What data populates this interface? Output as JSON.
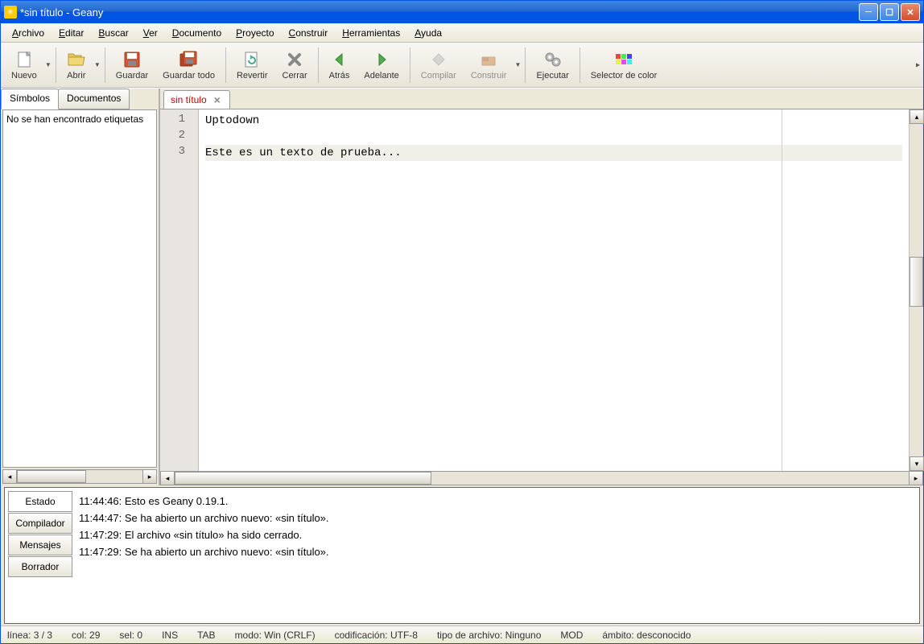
{
  "title": "*sin título - Geany",
  "menu": {
    "archivo": "Archivo",
    "editar": "Editar",
    "buscar": "Buscar",
    "ver": "Ver",
    "documento": "Documento",
    "proyecto": "Proyecto",
    "construir": "Construir",
    "herramientas": "Herramientas",
    "ayuda": "Ayuda"
  },
  "toolbar": {
    "nuevo": "Nuevo",
    "abrir": "Abrir",
    "guardar": "Guardar",
    "guardar_todo": "Guardar todo",
    "revertir": "Revertir",
    "cerrar": "Cerrar",
    "atras": "Atrás",
    "adelante": "Adelante",
    "compilar": "Compilar",
    "construir": "Construir",
    "ejecutar": "Ejecutar",
    "selector_color": "Selector de color"
  },
  "sidebar": {
    "tab_simbolos": "Símbolos",
    "tab_documentos": "Documentos",
    "no_tags": "No se han encontrado etiquetas"
  },
  "doc_tab": {
    "name": "sin título"
  },
  "editor": {
    "lines": [
      {
        "n": "1",
        "text": "Uptodown"
      },
      {
        "n": "2",
        "text": ""
      },
      {
        "n": "3",
        "text": "Este es un texto de prueba..."
      }
    ]
  },
  "messages": {
    "tab_estado": "Estado",
    "tab_compilador": "Compilador",
    "tab_mensajes": "Mensajes",
    "tab_borrador": "Borrador",
    "items": [
      "11:44:46: Esto es Geany 0.19.1.",
      "11:44:47: Se ha abierto un archivo nuevo: «sin título».",
      "11:47:29: El archivo «sin título» ha sido cerrado.",
      "11:47:29: Se ha abierto un archivo nuevo: «sin título»."
    ]
  },
  "status": {
    "linea": "línea: 3 / 3",
    "col": "col: 29",
    "sel": "sel: 0",
    "ins": "INS",
    "tab": "TAB",
    "modo": "modo: Win (CRLF)",
    "cod": "codificación: UTF-8",
    "tipo": "tipo de archivo: Ninguno",
    "mod": "MOD",
    "ambito": "ámbito: desconocido"
  }
}
